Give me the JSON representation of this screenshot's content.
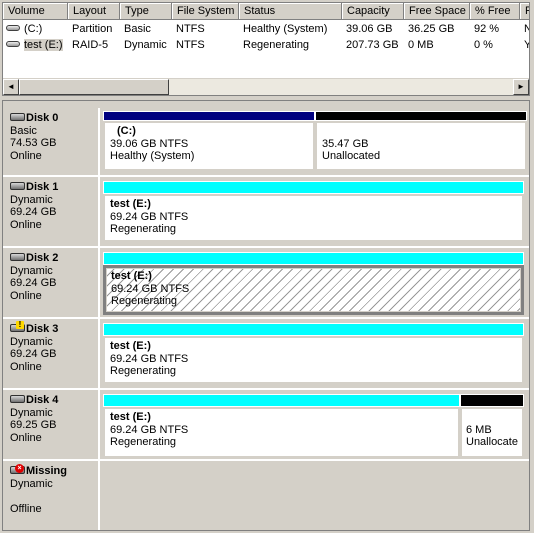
{
  "list": {
    "columns": [
      "Volume",
      "Layout",
      "Type",
      "File System",
      "Status",
      "Capacity",
      "Free Space",
      "% Free",
      "F"
    ],
    "rows": [
      {
        "volume": "(C:)",
        "layout": "Partition",
        "type": "Basic",
        "fs": "NTFS",
        "status": "Healthy (System)",
        "capacity": "39.06 GB",
        "free": "36.25 GB",
        "pct": "92 %",
        "extra": "N"
      },
      {
        "volume": "test (E:)",
        "layout": "RAID-5",
        "type": "Dynamic",
        "fs": "NTFS",
        "status": "Regenerating",
        "capacity": "207.73 GB",
        "free": "0 MB",
        "pct": "0 %",
        "extra": "Y"
      }
    ],
    "scroll_left_glyph": "◄",
    "scroll_right_glyph": "►"
  },
  "disks": [
    {
      "name": "Disk 0",
      "type": "Basic",
      "size": "74.53 GB",
      "state": "Online",
      "icon": "disk-icon",
      "parts": [
        {
          "title": "(C:)",
          "line2": "39.06 GB NTFS",
          "line3": "Healthy (System)",
          "bar": "#00007f"
        },
        {
          "title": "",
          "line2": "35.47 GB",
          "line3": "Unallocated",
          "bar": "#000000"
        }
      ]
    },
    {
      "name": "Disk 1",
      "type": "Dynamic",
      "size": "69.24 GB",
      "state": "Online",
      "icon": "disk-icon",
      "parts": [
        {
          "title": "test  (E:)",
          "line2": "69.24 GB NTFS",
          "line3": "Regenerating",
          "bar": "#00ffff"
        }
      ]
    },
    {
      "name": "Disk 2",
      "type": "Dynamic",
      "size": "69.24 GB",
      "state": "Online",
      "icon": "disk-icon",
      "parts": [
        {
          "title": "test  (E:)",
          "line2": "69.24 GB NTFS",
          "line3": "Regenerating",
          "bar": "#00ffff"
        }
      ]
    },
    {
      "name": "Disk 3",
      "type": "Dynamic",
      "size": "69.24 GB",
      "state": "Online",
      "icon": "disk-warning-icon",
      "parts": [
        {
          "title": "test  (E:)",
          "line2": "69.24 GB NTFS",
          "line3": "Regenerating",
          "bar": "#00ffff"
        }
      ]
    },
    {
      "name": "Disk 4",
      "type": "Dynamic",
      "size": "69.25 GB",
      "state": "Online",
      "icon": "disk-icon",
      "parts": [
        {
          "title": "test  (E:)",
          "line2": "69.24 GB NTFS",
          "line3": "Regenerating",
          "bar": "#00ffff"
        },
        {
          "title": "",
          "line2": "6 MB",
          "line3": "Unallocate",
          "bar": "#000000"
        }
      ]
    },
    {
      "name": "Missing",
      "type": "Dynamic",
      "size": "",
      "state": "Offline",
      "icon": "disk-missing-icon",
      "parts": []
    }
  ]
}
